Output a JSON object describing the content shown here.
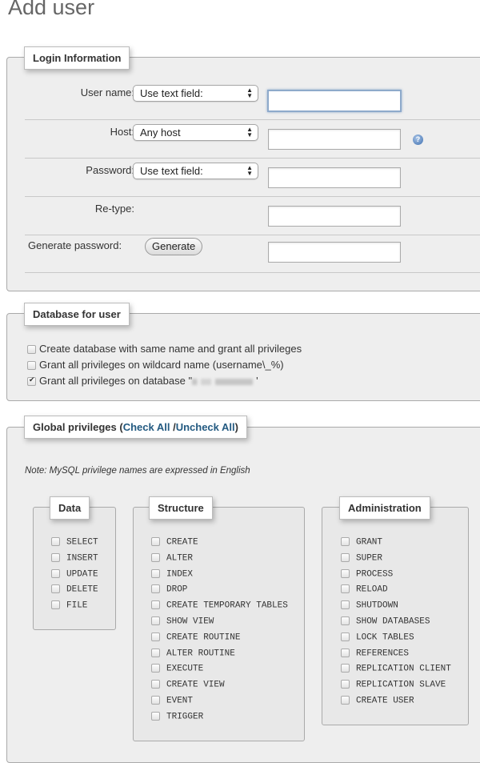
{
  "page": {
    "title": "Add user"
  },
  "login": {
    "legend": "Login Information",
    "rows": [
      {
        "label": "User name:",
        "select": "Use text field:",
        "value": ""
      },
      {
        "label": "Host:",
        "select": "Any host",
        "value": ""
      },
      {
        "label": "Password:",
        "select": "Use text field:",
        "value": ""
      },
      {
        "label": "Re-type:",
        "value": ""
      },
      {
        "label": "Generate password:",
        "button": "Generate",
        "value": ""
      }
    ],
    "help_icon": "help-icon"
  },
  "database": {
    "legend": "Database for user",
    "options": [
      {
        "label": "Create database with same name and grant all privileges",
        "checked": false
      },
      {
        "label": "Grant all privileges on wildcard name (username\\_%)",
        "checked": false
      },
      {
        "label": "Grant all privileges on database \"",
        "suffix": "'",
        "checked": true,
        "db_name_redacted": true
      }
    ]
  },
  "global": {
    "legend_prefix": "Global privileges (",
    "check_all": "Check All",
    "separator": " /",
    "uncheck_all": "Uncheck All",
    "legend_suffix": ")",
    "note": "Note: MySQL privilege names are expressed in English",
    "groups": [
      {
        "title": "Data",
        "items": [
          "SELECT",
          "INSERT",
          "UPDATE",
          "DELETE",
          "FILE"
        ]
      },
      {
        "title": "Structure",
        "items": [
          "CREATE",
          "ALTER",
          "INDEX",
          "DROP",
          "CREATE TEMPORARY TABLES",
          "SHOW VIEW",
          "CREATE ROUTINE",
          "ALTER ROUTINE",
          "EXECUTE",
          "CREATE VIEW",
          "EVENT",
          "TRIGGER"
        ]
      },
      {
        "title": "Administration",
        "items": [
          "GRANT",
          "SUPER",
          "PROCESS",
          "RELOAD",
          "SHUTDOWN",
          "SHOW DATABASES",
          "LOCK TABLES",
          "REFERENCES",
          "REPLICATION CLIENT",
          "REPLICATION SLAVE",
          "CREATE USER"
        ]
      }
    ]
  }
}
